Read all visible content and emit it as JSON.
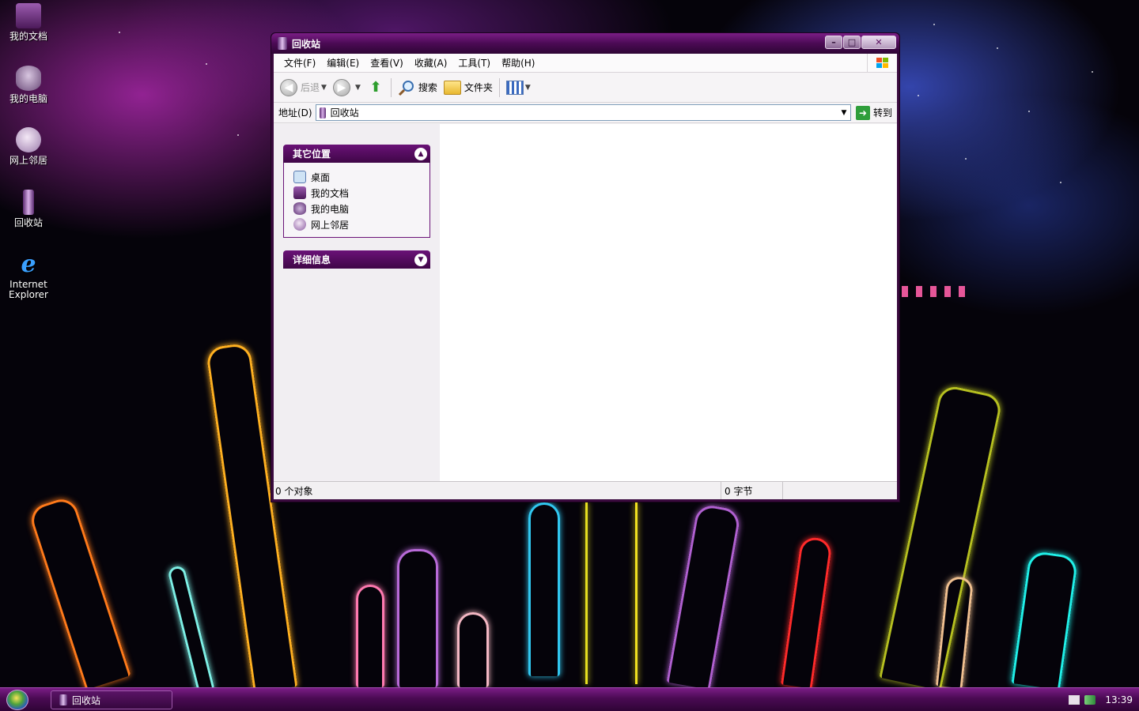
{
  "desktop": {
    "icons": [
      {
        "label": "我的文档",
        "icon": "my-documents-icon"
      },
      {
        "label": "我的电脑",
        "icon": "my-computer-icon"
      },
      {
        "label": "网上邻居",
        "icon": "network-places-icon"
      },
      {
        "label": "回收站",
        "icon": "recycle-bin-icon"
      },
      {
        "label": "Internet Explorer",
        "icon": "internet-explorer-icon"
      }
    ]
  },
  "window": {
    "title": "回收站",
    "controls": {
      "minimize": "–",
      "maximize": "□",
      "close": "✕"
    },
    "menu": [
      "文件(F)",
      "编辑(E)",
      "查看(V)",
      "收藏(A)",
      "工具(T)",
      "帮助(H)"
    ],
    "toolbar": {
      "back": "后退",
      "search": "搜索",
      "folders": "文件夹"
    },
    "address": {
      "label": "地址(D)",
      "value": "回收站",
      "go": "转到"
    },
    "taskpane": {
      "other_places": {
        "title": "其它位置",
        "items": [
          "桌面",
          "我的文档",
          "我的电脑",
          "网上邻居"
        ]
      },
      "details": {
        "title": "详细信息"
      }
    },
    "status": {
      "objects": "0 个对象",
      "size": "0 字节"
    }
  },
  "taskbar": {
    "task": "回收站",
    "clock": "13:39"
  },
  "colors": {
    "accent": "#4b0a54",
    "title_gradient_top": "#7a1d86",
    "title_gradient_bottom": "#2e0535"
  }
}
